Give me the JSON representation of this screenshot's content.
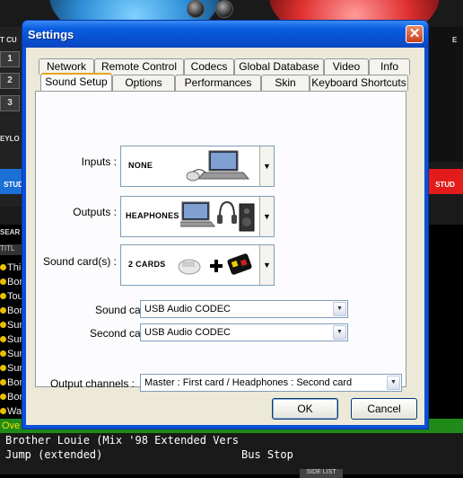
{
  "background_app": {
    "left_panel_label": "T CU",
    "numbers": [
      "1",
      "2",
      "3"
    ],
    "keylock_label": "EYLO",
    "left_button_label": "STUD",
    "right_button_label": "STUD",
    "right_panel_label": "E",
    "browser_header": "SEAR",
    "browser_col_header": "TITL",
    "tracks": [
      "Thi",
      "Bor",
      "Tou",
      "Bor",
      "Sur",
      "Sur",
      "Sur",
      "Sur",
      "Bor",
      "Bor",
      "Wa"
    ],
    "playing_track": "Ove",
    "bottom_rows": [
      {
        "title": "Brother Louie (Mix '98 Extended Vers",
        "artist": ""
      },
      {
        "title": "Jump (extended)",
        "artist": "Bus Stop"
      }
    ],
    "side_list_label": "SIDE LIST"
  },
  "dialog": {
    "title": "Settings",
    "close_glyph": "✕",
    "tabs_row1": [
      "Network",
      "Remote Control",
      "Codecs",
      "Global Database",
      "Video",
      "Info"
    ],
    "tabs_row2": [
      "Sound Setup",
      "Options",
      "Performances",
      "Skin",
      "Keyboard Shortcuts"
    ],
    "active_tab": "Sound Setup",
    "fields": {
      "inputs_label": "Inputs :",
      "inputs_value": "NONE",
      "outputs_label": "Outputs :",
      "outputs_value": "HEAPHONES",
      "soundcards_label": "Sound card(s) :",
      "soundcards_value": "2 CARDS",
      "soundcard_label": "Sound card :",
      "soundcard_value": "USB Audio CODEC",
      "secondcard_label": "Second card :",
      "secondcard_value": "USB Audio CODEC",
      "channels_label": "Output channels :",
      "channels_value": "Master : First card / Headphones : Second card"
    },
    "ok_label": "OK",
    "cancel_label": "Cancel"
  },
  "colors": {
    "titlebar_blue": "#0a5de0",
    "dialog_face": "#ece9d8",
    "deck_left": "#2e8fd8",
    "deck_right": "#e03030",
    "playing_green": "#1f8a18"
  }
}
